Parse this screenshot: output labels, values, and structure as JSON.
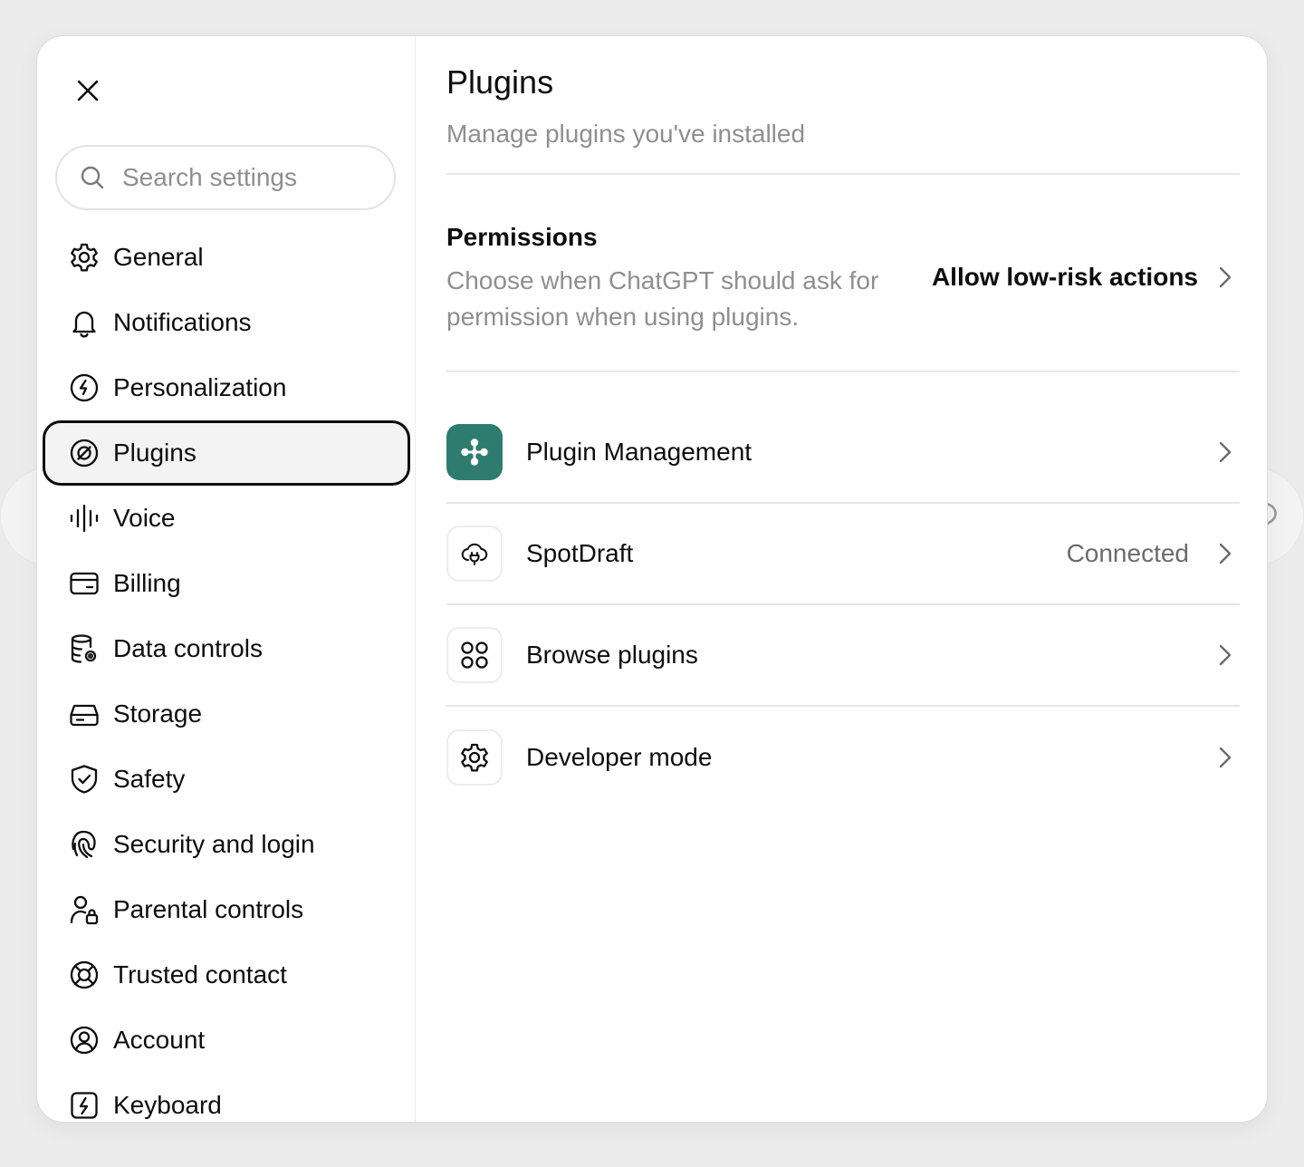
{
  "colors": {
    "brand_green": "#2e7c6f",
    "active_outline": "#0d0d0d",
    "muted_text": "#8f8f8f"
  },
  "sidebar": {
    "close_icon": "close-icon",
    "search": {
      "placeholder": "Search settings",
      "value": "",
      "icon": "search-icon"
    },
    "items": [
      {
        "label": "General",
        "icon": "gear-icon",
        "active": false
      },
      {
        "label": "Notifications",
        "icon": "bell-icon",
        "active": false
      },
      {
        "label": "Personalization",
        "icon": "personalization-icon",
        "active": false
      },
      {
        "label": "Plugins",
        "icon": "plugins-icon",
        "active": true
      },
      {
        "label": "Voice",
        "icon": "waveform-icon",
        "active": false
      },
      {
        "label": "Billing",
        "icon": "credit-card-icon",
        "active": false
      },
      {
        "label": "Data controls",
        "icon": "database-gear-icon",
        "active": false
      },
      {
        "label": "Storage",
        "icon": "drive-icon",
        "active": false
      },
      {
        "label": "Safety",
        "icon": "shield-check-icon",
        "active": false
      },
      {
        "label": "Security and login",
        "icon": "fingerprint-icon",
        "active": false
      },
      {
        "label": "Parental controls",
        "icon": "person-lock-icon",
        "active": false
      },
      {
        "label": "Trusted contact",
        "icon": "lifebuoy-icon",
        "active": false
      },
      {
        "label": "Account",
        "icon": "user-circle-icon",
        "active": false
      },
      {
        "label": "Keyboard",
        "icon": "keyboard-bolt-icon",
        "active": false
      }
    ]
  },
  "main": {
    "title": "Plugins",
    "subtitle": "Manage plugins you've installed",
    "permissions": {
      "title": "Permissions",
      "description": "Choose when ChatGPT should ask for permission when using plugins.",
      "action_label": "Allow low-risk actions"
    },
    "rows": [
      {
        "label": "Plugin Management",
        "icon": "plugin-management-icon",
        "status": ""
      },
      {
        "label": "SpotDraft",
        "icon": "cloud-plug-icon",
        "status": "Connected"
      },
      {
        "label": "Browse plugins",
        "icon": "grid-circles-icon",
        "status": ""
      },
      {
        "label": "Developer mode",
        "icon": "gear-icon",
        "status": ""
      }
    ]
  }
}
